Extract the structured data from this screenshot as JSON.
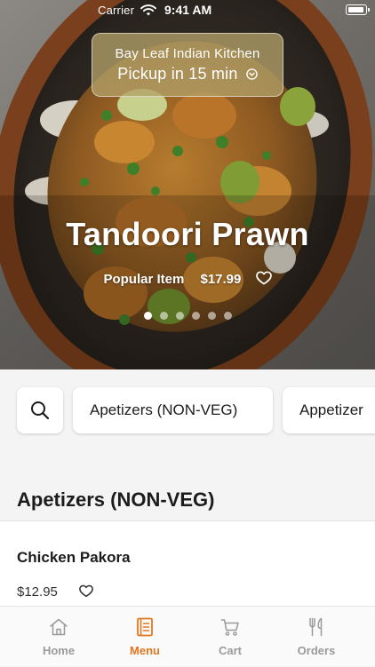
{
  "status_bar": {
    "carrier": "Carrier",
    "time": "9:41 AM"
  },
  "store": {
    "name": "Bay Leaf Indian Kitchen",
    "pickup": "Pickup in 15 min",
    "pill_color": "#b2a068"
  },
  "featured": {
    "title": "Tandoori Prawn",
    "tag": "Popular Item",
    "price": "$17.99",
    "slide_count": 6,
    "active_slide": 1
  },
  "categories": {
    "items": [
      "Apetizers (NON-VEG)",
      "Appetizer"
    ]
  },
  "section": {
    "title": "Apetizers (NON-VEG)",
    "items": [
      {
        "name": "Chicken Pakora",
        "price": "$12.95"
      }
    ]
  },
  "tabs": [
    {
      "label": "Home",
      "icon": "home-icon",
      "active": false
    },
    {
      "label": "Menu",
      "icon": "menu-book-icon",
      "active": true
    },
    {
      "label": "Cart",
      "icon": "cart-icon",
      "active": false
    },
    {
      "label": "Orders",
      "icon": "fork-knife-icon",
      "active": false
    }
  ],
  "colors": {
    "accent": "#e2771e",
    "inactive_tab": "#9a9a9a",
    "background": "#f4f4f4"
  }
}
